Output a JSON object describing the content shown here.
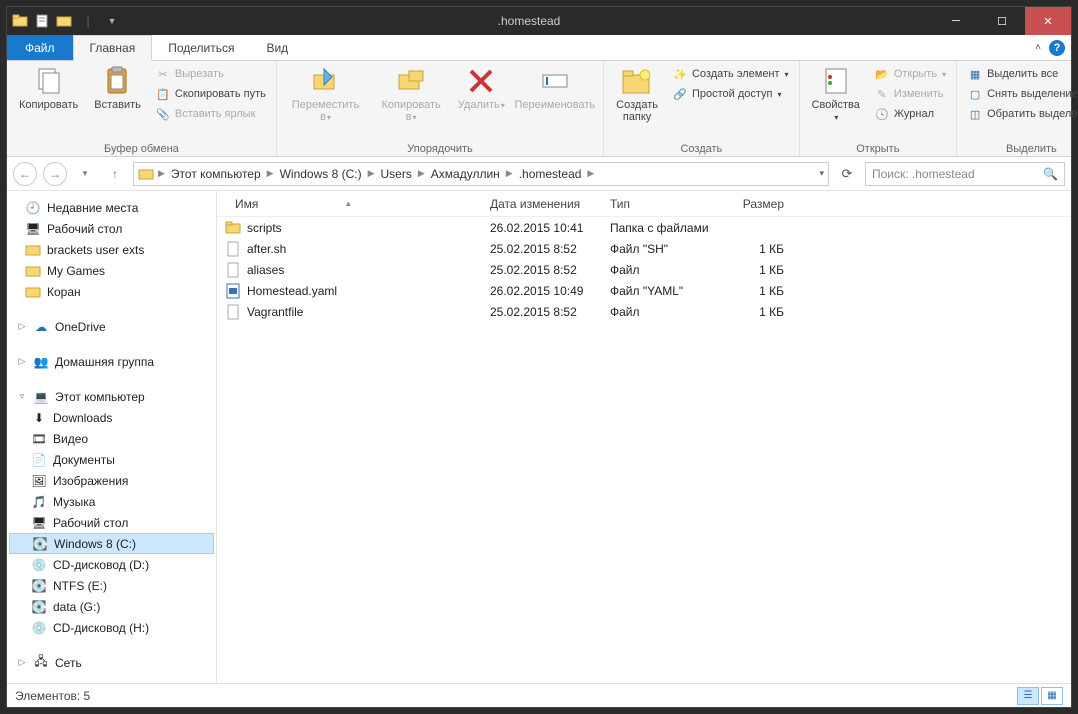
{
  "window": {
    "title": ".homestead"
  },
  "tabs": {
    "file": "Файл",
    "home": "Главная",
    "share": "Поделиться",
    "view": "Вид"
  },
  "ribbon": {
    "clipboard": {
      "copy": "Копировать",
      "paste": "Вставить",
      "cut": "Вырезать",
      "copy_path": "Скопировать путь",
      "paste_shortcut": "Вставить ярлык",
      "group": "Буфер обмена"
    },
    "organize": {
      "move_to": "Переместить в",
      "copy_to": "Копировать в",
      "delete": "Удалить",
      "rename": "Переименовать",
      "group": "Упорядочить"
    },
    "new": {
      "new_folder": "Создать папку",
      "new_item": "Создать элемент",
      "easy_access": "Простой доступ",
      "group": "Создать"
    },
    "open": {
      "properties": "Свойства",
      "open": "Открыть",
      "edit": "Изменить",
      "history": "Журнал",
      "group": "Открыть"
    },
    "select": {
      "select_all": "Выделить все",
      "select_none": "Снять выделение",
      "invert": "Обратить выделение",
      "group": "Выделить"
    }
  },
  "breadcrumbs": [
    "Этот компьютер",
    "Windows 8 (C:)",
    "Users",
    "Ахмадуллин",
    ".homestead"
  ],
  "search": {
    "placeholder": "Поиск: .homestead"
  },
  "sidebar": {
    "recent": "Недавние места",
    "desktop": "Рабочий стол",
    "brackets": "brackets user exts",
    "mygames": "My Games",
    "koran": "Коран",
    "onedrive": "OneDrive",
    "homegroup": "Домашняя группа",
    "thispc": "Этот компьютер",
    "downloads": "Downloads",
    "videos": "Видео",
    "documents": "Документы",
    "pictures": "Изображения",
    "music": "Музыка",
    "desktop2": "Рабочий стол",
    "drive_c": "Windows 8 (C:)",
    "drive_d": "CD-дисковод (D:)",
    "drive_e": "NTFS (E:)",
    "drive_g": "data (G:)",
    "drive_h": "CD-дисковод (H:)",
    "network": "Сеть"
  },
  "columns": {
    "name": "Имя",
    "date": "Дата изменения",
    "type": "Тип",
    "size": "Размер"
  },
  "files": [
    {
      "name": "scripts",
      "date": "26.02.2015 10:41",
      "type": "Папка с файлами",
      "size": "",
      "icon": "folder"
    },
    {
      "name": "after.sh",
      "date": "25.02.2015 8:52",
      "type": "Файл \"SH\"",
      "size": "1 КБ",
      "icon": "file"
    },
    {
      "name": "aliases",
      "date": "25.02.2015 8:52",
      "type": "Файл",
      "size": "1 КБ",
      "icon": "file"
    },
    {
      "name": "Homestead.yaml",
      "date": "26.02.2015 10:49",
      "type": "Файл \"YAML\"",
      "size": "1 КБ",
      "icon": "yaml"
    },
    {
      "name": "Vagrantfile",
      "date": "25.02.2015 8:52",
      "type": "Файл",
      "size": "1 КБ",
      "icon": "file"
    }
  ],
  "status": {
    "count": "Элементов: 5"
  }
}
